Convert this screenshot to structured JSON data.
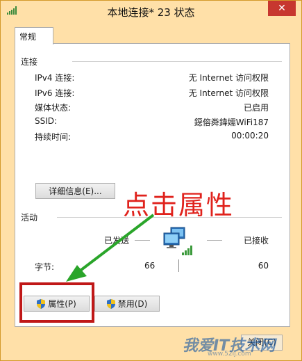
{
  "window": {
    "title": "本地连接* 23 状态",
    "close_glyph": "✕"
  },
  "tabs": [
    {
      "label": "常规"
    }
  ],
  "connection": {
    "title": "连接",
    "rows": [
      {
        "label": "IPv4 连接:",
        "value": "无 Internet 访问权限"
      },
      {
        "label": "IPv6 连接:",
        "value": "无 Internet 访问权限"
      },
      {
        "label": "媒体状态:",
        "value": "已启用"
      },
      {
        "label": "SSID:",
        "value": "鐚傛粦鍏嬬WiFi187"
      },
      {
        "label": "持续时间:",
        "value": "00:00:20"
      }
    ],
    "details_button": "详细信息(E)..."
  },
  "activity": {
    "title": "活动",
    "sent_label": "已发送",
    "received_label": "已接收",
    "bytes_label": "字节:",
    "bytes_sent": "66",
    "bytes_received": "60"
  },
  "buttons": {
    "properties": "属性(P)",
    "disable": "禁用(D)",
    "close": "关闭(C)"
  },
  "annotation": {
    "text": "点击属性",
    "color": "#e0221c",
    "arrow_color": "#2aa52a"
  },
  "watermark": {
    "text": "我爱IT技术网",
    "url": "www.52ij.com"
  },
  "colors": {
    "frame": "#ffe0a8",
    "close": "#c7372f"
  }
}
